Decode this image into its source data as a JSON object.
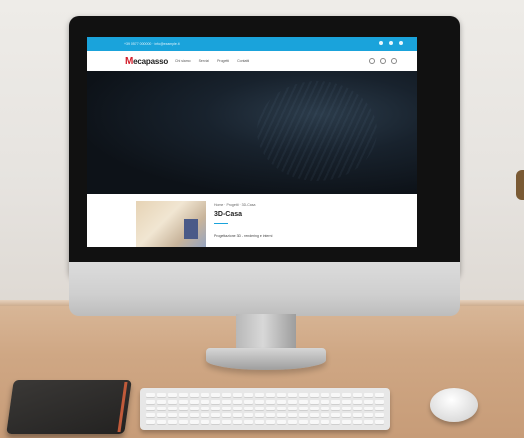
{
  "topbar": {
    "contact": "+39 0577 000000 · info@example.it",
    "social_icons": [
      "facebook-icon",
      "twitter-icon",
      "instagram-icon"
    ]
  },
  "nav": {
    "logo_initial": "M",
    "logo_rest": "ecapasso",
    "items": [
      "Chi siamo",
      "Servizi",
      "Progetti",
      "Contatti"
    ],
    "icons": [
      "user-icon",
      "search-icon",
      "menu-icon"
    ]
  },
  "content": {
    "breadcrumb": "Home · Progetti · 3D-Casa",
    "title": "3D-Casa",
    "description": "Progettazione 3D - rendering e interni"
  },
  "colors": {
    "topbar": "#1aa3db",
    "logo_accent": "#d21e2b",
    "hero": "#0d1218"
  }
}
